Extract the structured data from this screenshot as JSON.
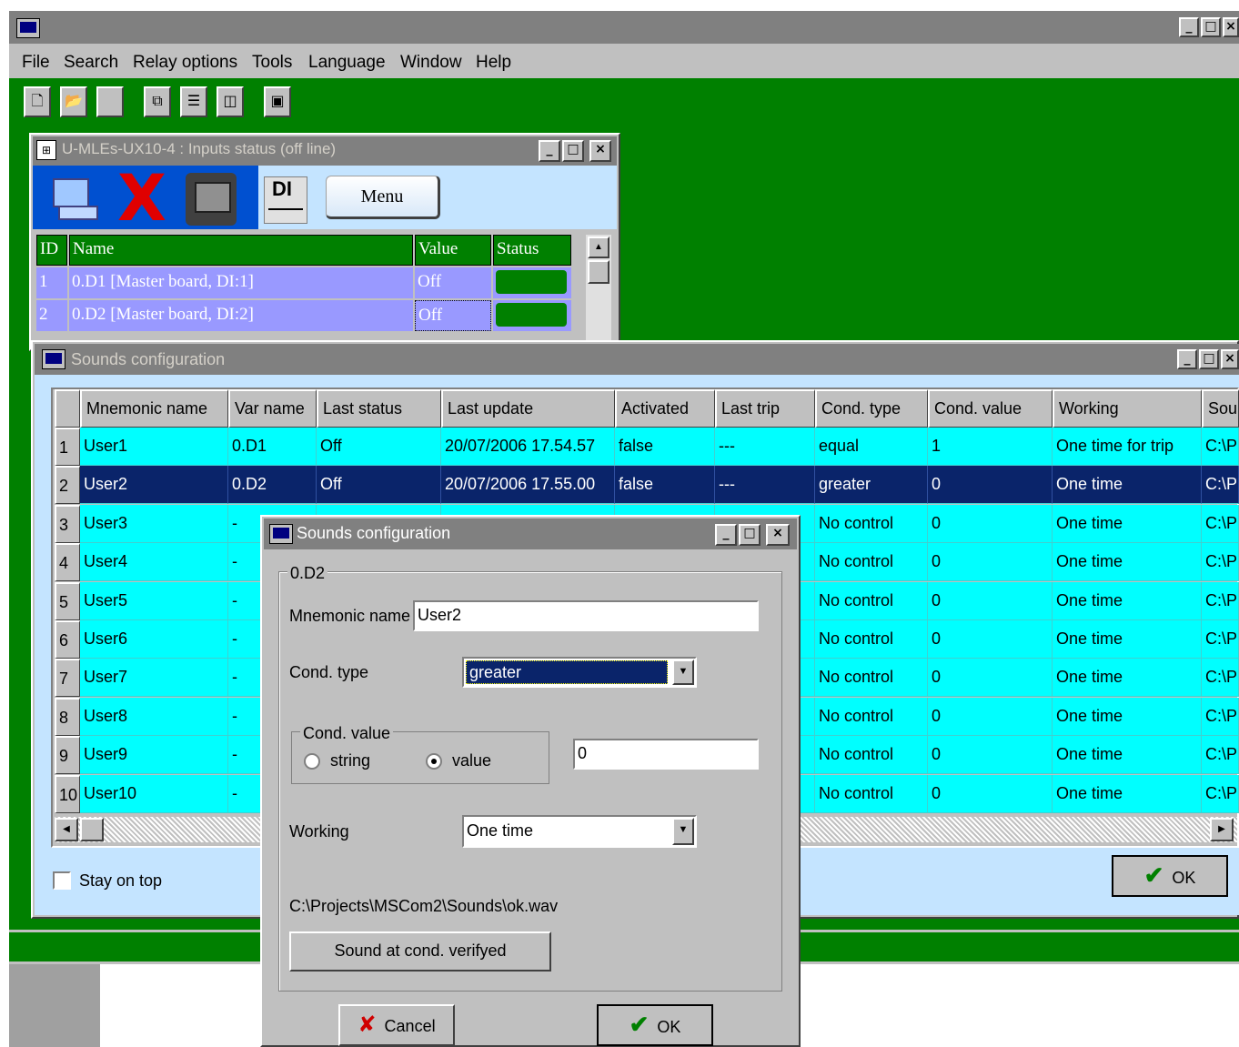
{
  "app": {
    "menu": [
      "File",
      "Search",
      "Relay options",
      "Tools",
      "Language",
      "Window",
      "Help"
    ],
    "toolbar_icons": [
      "new-file-icon",
      "open-folder-icon",
      "blank-icon",
      "cascade-windows-icon",
      "tile-horizontal-icon",
      "tile-vertical-icon",
      "screen-icon"
    ]
  },
  "inputs_window": {
    "title": "U-MLEs-UX10-4 : Inputs status (off line)",
    "menu_button": "Menu",
    "di_label": "DI",
    "columns": [
      "ID",
      "Name",
      "Value",
      "Status"
    ],
    "rows": [
      {
        "id": "1",
        "name": "0.D1 [Master board, DI:1]",
        "value": "Off"
      },
      {
        "id": "2",
        "name": "0.D2 [Master board, DI:2]",
        "value": "Off"
      }
    ]
  },
  "sounds_window": {
    "title": "Sounds configuration",
    "columns": [
      "Mnemonic name",
      "Var name",
      "Last status",
      "Last update",
      "Activated",
      "Last trip",
      "Cond. type",
      "Cond. value",
      "Working",
      "Sou"
    ],
    "rows": [
      {
        "n": "1",
        "mnemonic": "User1",
        "var": "0.D1",
        "status": "Off",
        "update": "20/07/2006 17.54.57",
        "activated": "false",
        "trip": "---",
        "cond_type": "equal",
        "cond_value": "1",
        "working": "One time for trip",
        "sound": "C:\\P"
      },
      {
        "n": "2",
        "mnemonic": "User2",
        "var": "0.D2",
        "status": "Off",
        "update": "20/07/2006 17.55.00",
        "activated": "false",
        "trip": "---",
        "cond_type": "greater",
        "cond_value": "0",
        "working": "One time",
        "sound": "C:\\P"
      },
      {
        "n": "3",
        "mnemonic": "User3",
        "var": "-",
        "status": "",
        "update": "",
        "activated": "",
        "trip": "",
        "cond_type": "No control",
        "cond_value": "0",
        "working": "One time",
        "sound": "C:\\P"
      },
      {
        "n": "4",
        "mnemonic": "User4",
        "var": "-",
        "status": "",
        "update": "",
        "activated": "",
        "trip": "",
        "cond_type": "No control",
        "cond_value": "0",
        "working": "One time",
        "sound": "C:\\P"
      },
      {
        "n": "5",
        "mnemonic": "User5",
        "var": "-",
        "status": "",
        "update": "",
        "activated": "",
        "trip": "",
        "cond_type": "No control",
        "cond_value": "0",
        "working": "One time",
        "sound": "C:\\P"
      },
      {
        "n": "6",
        "mnemonic": "User6",
        "var": "-",
        "status": "",
        "update": "",
        "activated": "",
        "trip": "",
        "cond_type": "No control",
        "cond_value": "0",
        "working": "One time",
        "sound": "C:\\P"
      },
      {
        "n": "7",
        "mnemonic": "User7",
        "var": "-",
        "status": "",
        "update": "",
        "activated": "",
        "trip": "",
        "cond_type": "No control",
        "cond_value": "0",
        "working": "One time",
        "sound": "C:\\P"
      },
      {
        "n": "8",
        "mnemonic": "User8",
        "var": "-",
        "status": "",
        "update": "",
        "activated": "",
        "trip": "",
        "cond_type": "No control",
        "cond_value": "0",
        "working": "One time",
        "sound": "C:\\P"
      },
      {
        "n": "9",
        "mnemonic": "User9",
        "var": "-",
        "status": "",
        "update": "",
        "activated": "",
        "trip": "",
        "cond_type": "No control",
        "cond_value": "0",
        "working": "One time",
        "sound": "C:\\P"
      },
      {
        "n": "10",
        "mnemonic": "User10",
        "var": "-",
        "status": "",
        "update": "",
        "activated": "",
        "trip": "",
        "cond_type": "No control",
        "cond_value": "0",
        "working": "One time",
        "sound": "C:\\P"
      }
    ],
    "stay_on_top": "Stay on top",
    "ok": "OK"
  },
  "dialog": {
    "title": "Sounds configuration",
    "group_label": "0.D2",
    "mnemonic_label": "Mnemonic name",
    "mnemonic_value": "User2",
    "cond_type_label": "Cond. type",
    "cond_type_value": "greater",
    "cond_value_label": "Cond. value",
    "radio_string": "string",
    "radio_value": "value",
    "cond_value_input": "0",
    "working_label": "Working",
    "working_value": "One time",
    "sound_path": "C:\\Projects\\MSCom2\\Sounds\\ok.wav",
    "sound_button": "Sound at cond. verifyed",
    "cancel": "Cancel",
    "ok": "OK"
  },
  "colors": {
    "desktop": "#008000",
    "grid_row": "#00ffff",
    "selected_row": "#0a246a",
    "inputs_row": "#9999ff"
  }
}
